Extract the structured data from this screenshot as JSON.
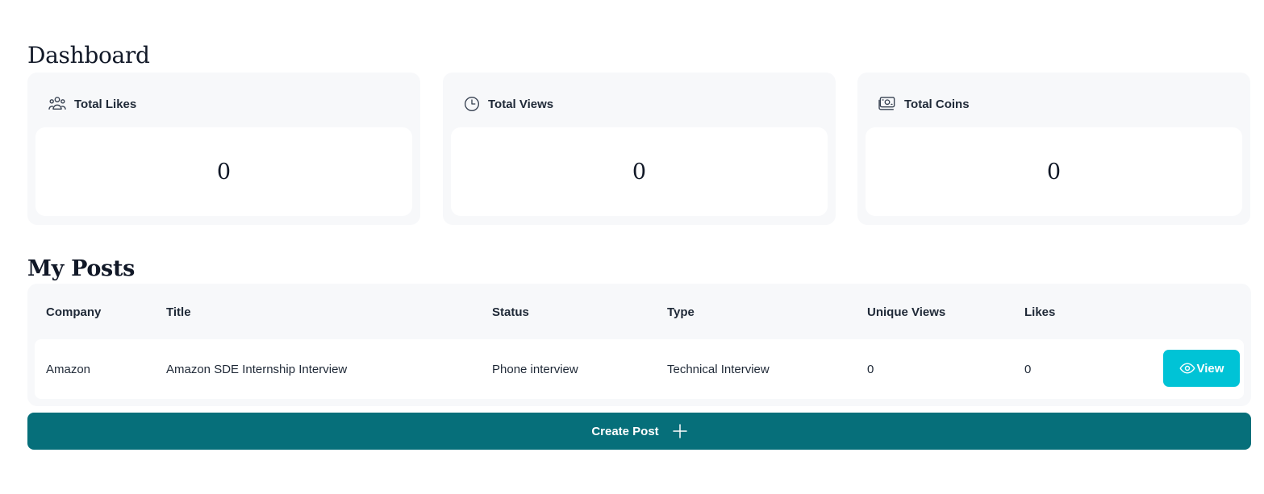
{
  "dashboard": {
    "title": "Dashboard",
    "stats": [
      {
        "icon": "users-icon",
        "label": "Total Likes",
        "value": "0"
      },
      {
        "icon": "clock-icon",
        "label": "Total Views",
        "value": "0"
      },
      {
        "icon": "cash-icon",
        "label": "Total Coins",
        "value": "0"
      }
    ]
  },
  "posts": {
    "title": "My Posts",
    "columns": [
      "Company",
      "Title",
      "Status",
      "Type",
      "Unique Views",
      "Likes"
    ],
    "rows": [
      {
        "company": "Amazon",
        "title": "Amazon SDE Internship Interview",
        "status": "Phone interview",
        "type": "Technical Interview",
        "unique_views": "0",
        "likes": "0",
        "view_label": "View"
      }
    ],
    "create_label": "Create Post"
  },
  "colors": {
    "accent": "#066f7a",
    "view_button": "#00c3d6",
    "card_bg": "#f7f8fa"
  }
}
